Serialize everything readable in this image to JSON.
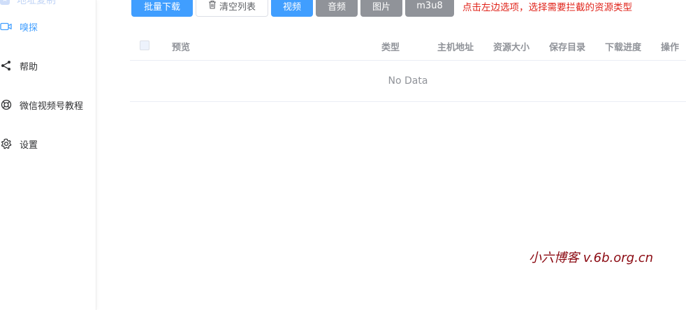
{
  "sidebar": {
    "top_item": {
      "label": "地址复制",
      "icon": "star-icon"
    },
    "items": [
      {
        "label": "嗅探",
        "icon": "video-camera-icon",
        "active": true
      },
      {
        "label": "帮助",
        "icon": "share-icon",
        "active": false
      },
      {
        "label": "微信视频号教程",
        "icon": "lifebuoy-icon",
        "active": false
      },
      {
        "label": "设置",
        "icon": "gear-icon",
        "active": false
      }
    ]
  },
  "toolbar": {
    "batch_download": "批量下载",
    "clear_list": "清空列表",
    "video": "视频",
    "audio": "音频",
    "image": "图片",
    "m3u8": "m3u8",
    "hint": "点击左边选项，选择需要拦截的资源类型"
  },
  "table": {
    "columns": [
      "预览",
      "类型",
      "主机地址",
      "资源大小",
      "保存目录",
      "下载进度",
      "操作"
    ],
    "empty_text": "No Data"
  },
  "watermark": "小六博客 v.6b.org.cn",
  "colors": {
    "primary": "#409eff",
    "info": "#909399",
    "hint": "#e0241b",
    "watermark": "#8b0a12"
  }
}
